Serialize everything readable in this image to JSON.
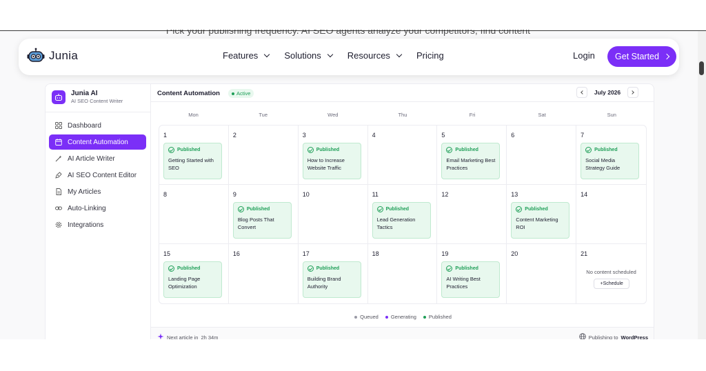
{
  "background_text": "Pick your publishing frequency. AI SEO agents analyze your competitors, find content",
  "nav": {
    "logo_text": "Junia",
    "links": [
      {
        "label": "Features",
        "has_dropdown": true
      },
      {
        "label": "Solutions",
        "has_dropdown": true
      },
      {
        "label": "Resources",
        "has_dropdown": true
      },
      {
        "label": "Pricing",
        "has_dropdown": false
      }
    ],
    "login_label": "Login",
    "cta_label": "Get Started",
    "accent_color": "#7b2ff7"
  },
  "sidebar": {
    "brand_name": "Junia AI",
    "brand_subtitle": "AI SEO Content Writer",
    "items": [
      {
        "label": "Dashboard",
        "icon": "grid-icon",
        "active": false
      },
      {
        "label": "Content Automation",
        "icon": "calendar-icon",
        "active": true
      },
      {
        "label": "AI Article Writer",
        "icon": "magic-wand-icon",
        "active": false
      },
      {
        "label": "AI SEO Content Editor",
        "icon": "pen-nib-icon",
        "active": false
      },
      {
        "label": "My Articles",
        "icon": "document-icon",
        "active": false
      },
      {
        "label": "Auto-Linking",
        "icon": "link-icon",
        "active": false
      },
      {
        "label": "Integrations",
        "icon": "gear-icon",
        "active": false
      }
    ]
  },
  "calendar": {
    "title": "Content Automation",
    "status_badge": "Active",
    "month_label": "July 2026",
    "weekdays": [
      "Mon",
      "Tue",
      "Wed",
      "Thu",
      "Fri",
      "Sat",
      "Sun"
    ],
    "days": [
      {
        "day": "1",
        "status": "Published",
        "title": "Getting Started with SEO"
      },
      {
        "day": "2"
      },
      {
        "day": "3",
        "status": "Published",
        "title": "How to Increase Website Traffic"
      },
      {
        "day": "4"
      },
      {
        "day": "5",
        "status": "Published",
        "title": "Email Marketing Best Practices"
      },
      {
        "day": "6"
      },
      {
        "day": "7",
        "status": "Published",
        "title": "Social Media Strategy Guide"
      },
      {
        "day": "8"
      },
      {
        "day": "9",
        "status": "Published",
        "title": "Blog Posts That Convert"
      },
      {
        "day": "10"
      },
      {
        "day": "11",
        "status": "Published",
        "title": "Lead Generation Tactics"
      },
      {
        "day": "12"
      },
      {
        "day": "13",
        "status": "Published",
        "title": "Content Marketing ROI"
      },
      {
        "day": "14"
      },
      {
        "day": "15",
        "status": "Published",
        "title": "Landing Page Optimization"
      },
      {
        "day": "16"
      },
      {
        "day": "17",
        "status": "Published",
        "title": "Building Brand Authority"
      },
      {
        "day": "18"
      },
      {
        "day": "19",
        "status": "Published",
        "title": "AI Writing Best Practices"
      },
      {
        "day": "20"
      },
      {
        "day": "21",
        "empty_message": "No content scheduled",
        "action_label": "+Schedule"
      }
    ],
    "legend": [
      {
        "label": "Queued",
        "color": "#9a9aa6"
      },
      {
        "label": "Generating",
        "color": "#7b2ff7"
      },
      {
        "label": "Published",
        "color": "#1e9e57"
      }
    ],
    "footer": {
      "next_article_label": "Next article in",
      "next_article_time": "2h 34m",
      "publishing_label": "Publishing to",
      "publishing_target": "WordPress"
    }
  }
}
